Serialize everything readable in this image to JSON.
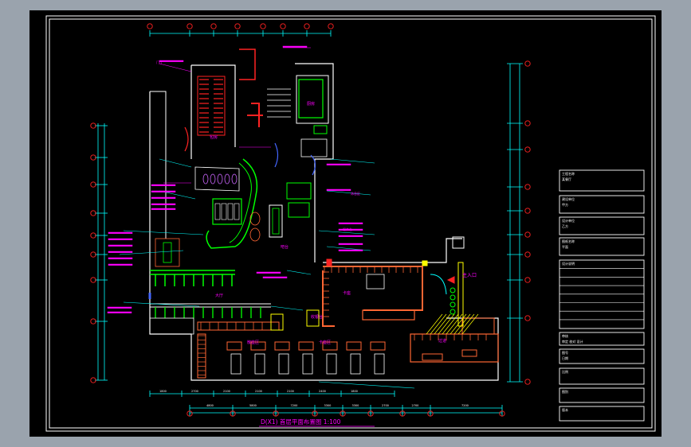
{
  "viewport": {
    "background": "#9aa3ad",
    "sheet": "#000000"
  },
  "colors": {
    "frame": "#ffffff",
    "wall": "#ffffff",
    "dim": "#00ffff",
    "annot": "#ff00ff",
    "fixture": "#00ff00",
    "furniture": "#ff6633",
    "hatch": "#ffff00",
    "stair": "#ff2222",
    "door": "#4466ff",
    "extra": "#cc66ff"
  },
  "drawing": {
    "title": "D(X1) 首层平面布置图 1:100",
    "top_dims": [
      "",
      "",
      "",
      "",
      "",
      "",
      ""
    ],
    "bottom_dims_1": [
      "1800",
      "2700",
      "2100",
      "2100",
      "2100",
      "2400",
      "1800"
    ],
    "bottom_dims_2": [
      "4800",
      "5800",
      "7200",
      "3300",
      "3300",
      "2700",
      "2700",
      "7200"
    ],
    "right_dims": [
      "",
      "",
      "",
      "",
      "",
      "",
      "",
      ""
    ],
    "rooms": {
      "cashier": "收银台",
      "private_room": "包房",
      "kitchen": "厨房",
      "counter": "吧台",
      "dining_hall": "大厅",
      "main_entrance": "主入口",
      "card_area": "卡座区",
      "booth_1": "卡座",
      "booth_2": "散座区",
      "corridor": "过道"
    },
    "annotations": [
      "门厅",
      "休息区",
      "服务台"
    ]
  },
  "title_block": {
    "rows": [
      {
        "label": "工程名称",
        "value": "某餐厅"
      },
      {
        "label": "建设单位",
        "value": "甲方"
      },
      {
        "label": "设计单位",
        "value": "乙方"
      },
      {
        "label": "图纸名称",
        "value": "平面"
      },
      {
        "label": "设计说明",
        "value": ""
      },
      {
        "label": "审核",
        "value": "审定 校对 设计"
      },
      {
        "label": "图号",
        "value": "日期"
      },
      {
        "label": "比例",
        "value": ""
      },
      {
        "label": "图别",
        "value": ""
      },
      {
        "label": "版本",
        "value": ""
      }
    ]
  }
}
